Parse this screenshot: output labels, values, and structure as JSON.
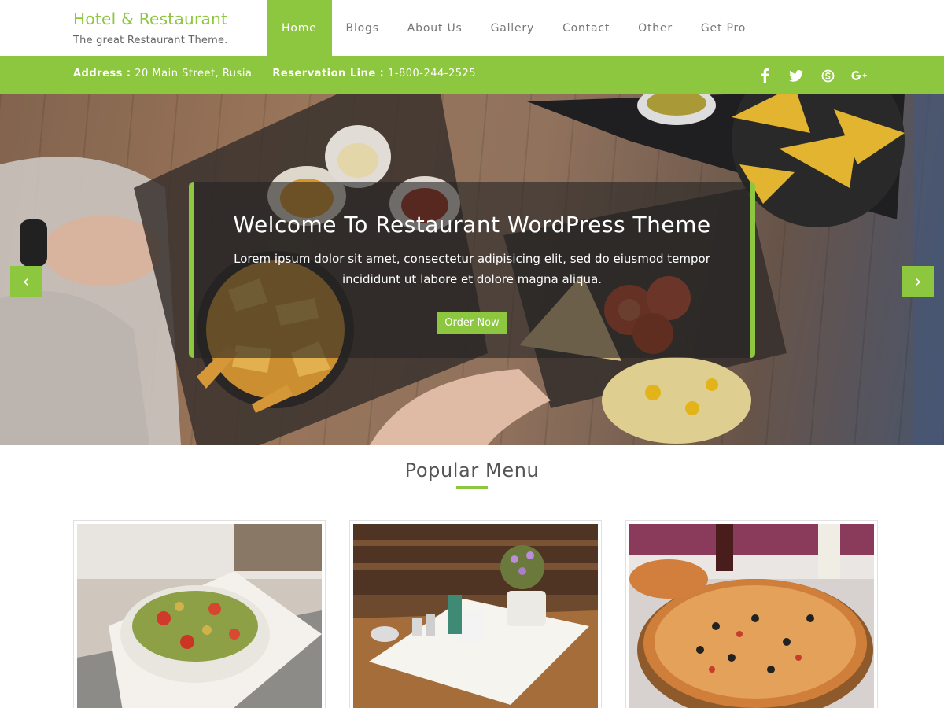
{
  "brand": {
    "title": "Hotel & Restaurant",
    "tagline": "The great Restaurant Theme."
  },
  "nav": {
    "items": [
      {
        "label": "Home",
        "active": true
      },
      {
        "label": "Blogs"
      },
      {
        "label": "About Us"
      },
      {
        "label": "Gallery"
      },
      {
        "label": "Contact"
      },
      {
        "label": "Other"
      },
      {
        "label": "Get Pro"
      }
    ]
  },
  "infobar": {
    "address_label": "Address :",
    "address_value": "20 Main Street, Rusia",
    "reservation_label": "Reservation Line :",
    "reservation_value": "1-800-244-2525",
    "social": [
      {
        "icon": "facebook-icon",
        "glyph": "f"
      },
      {
        "icon": "twitter-icon",
        "glyph": "t"
      },
      {
        "icon": "skype-icon",
        "glyph": "S"
      },
      {
        "icon": "google-plus-icon",
        "glyph": "G+"
      }
    ]
  },
  "hero": {
    "title": "Welcome To Restaurant WordPress Theme",
    "text": "Lorem ipsum dolor sit amet, consectetur adipisicing elit, sed do eiusmod tempor incididunt ut labore et dolore magna aliqua.",
    "button": "Order Now",
    "prev_glyph": "‹",
    "next_glyph": "›"
  },
  "popular": {
    "title": "Popular Menu",
    "cards": [
      {
        "name": "pasta-salad-image"
      },
      {
        "name": "cafe-table-image"
      },
      {
        "name": "pizza-image"
      }
    ]
  },
  "colors": {
    "accent": "#8dc63f",
    "text": "#555555"
  }
}
